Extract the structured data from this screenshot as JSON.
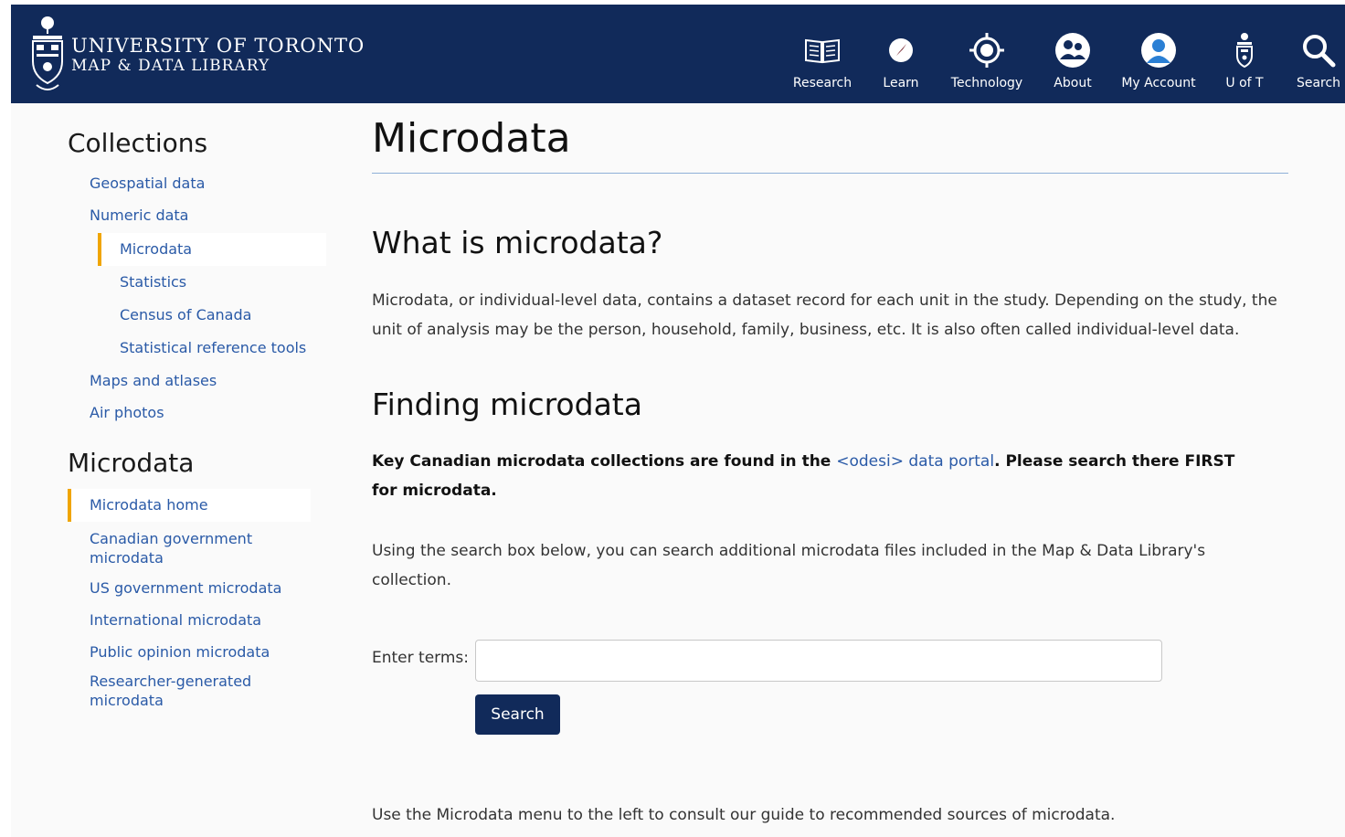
{
  "header": {
    "logo_line1": "UNIVERSITY OF TORONTO",
    "logo_line2": "MAP & DATA LIBRARY",
    "nav": [
      {
        "label": "Research",
        "icon": "book-icon"
      },
      {
        "label": "Learn",
        "icon": "compass-icon"
      },
      {
        "label": "Technology",
        "icon": "gear-target-icon"
      },
      {
        "label": "About",
        "icon": "people-icon"
      },
      {
        "label": "My Account",
        "icon": "user-icon"
      },
      {
        "label": "U of T",
        "icon": "crest-icon"
      },
      {
        "label": "Search",
        "icon": "search-icon"
      }
    ]
  },
  "sidebar": {
    "collections_heading": "Collections",
    "collections": [
      {
        "label": "Geospatial data"
      },
      {
        "label": "Numeric data"
      },
      {
        "label": "Microdata"
      },
      {
        "label": "Statistics"
      },
      {
        "label": "Census of Canada"
      },
      {
        "label": "Statistical reference tools"
      },
      {
        "label": "Maps and atlases"
      },
      {
        "label": "Air photos"
      }
    ],
    "microdata_heading": "Microdata",
    "microdata": [
      {
        "label": "Microdata home"
      },
      {
        "label": "Canadian government microdata"
      },
      {
        "label": "US government microdata"
      },
      {
        "label": "International microdata"
      },
      {
        "label": "Public opinion microdata"
      },
      {
        "label": "Researcher-generated microdata"
      }
    ]
  },
  "main": {
    "title": "Microdata",
    "what_heading": "What is microdata?",
    "what_para": "Microdata, or individual-level data, contains a dataset record for each unit in the study. Depending on the study, the unit of analysis may be the person, household, family, business, etc. It is also often called individual-level data.",
    "finding_heading": "Finding microdata",
    "key_before": "Key Canadian microdata collections are found in the ",
    "key_link": "<odesi> data portal",
    "key_after": ". Please search there FIRST for microdata.",
    "using_para": "Using the search box below, you can search additional microdata files included in the Map & Data Library's collection.",
    "search_label": "Enter terms:",
    "search_value": "",
    "search_placeholder": "",
    "search_button": "Search",
    "footer_para": "Use the Microdata menu to the left to consult our guide to recommended sources of microdata."
  },
  "colors": {
    "header_bg": "#112a5a",
    "link": "#2a5aa7",
    "active_bar": "#f0a500",
    "rule": "#8fb0d8"
  }
}
